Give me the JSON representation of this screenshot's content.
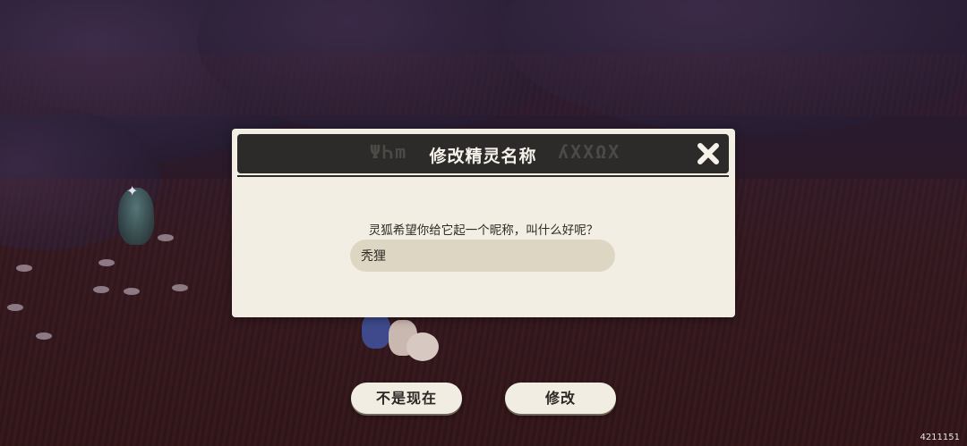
{
  "dialog": {
    "title": "修改精灵名称",
    "header_glyphs_left": "ΨᏂm",
    "header_glyphs_right": "ʎXXΩΧ",
    "prompt": "灵狐希望你给它起一个昵称，叫什么好呢？",
    "name_value": "秃狸",
    "close_icon": "close-icon"
  },
  "buttons": {
    "later_label": "不是现在",
    "confirm_label": "修改"
  },
  "footer": {
    "version": "4211151"
  },
  "colors": {
    "dialog_bg": "#f3eee4",
    "header_bg": "#2d2b2a",
    "input_bg": "#ddd6c2",
    "button_bg": "#f2ede2"
  }
}
